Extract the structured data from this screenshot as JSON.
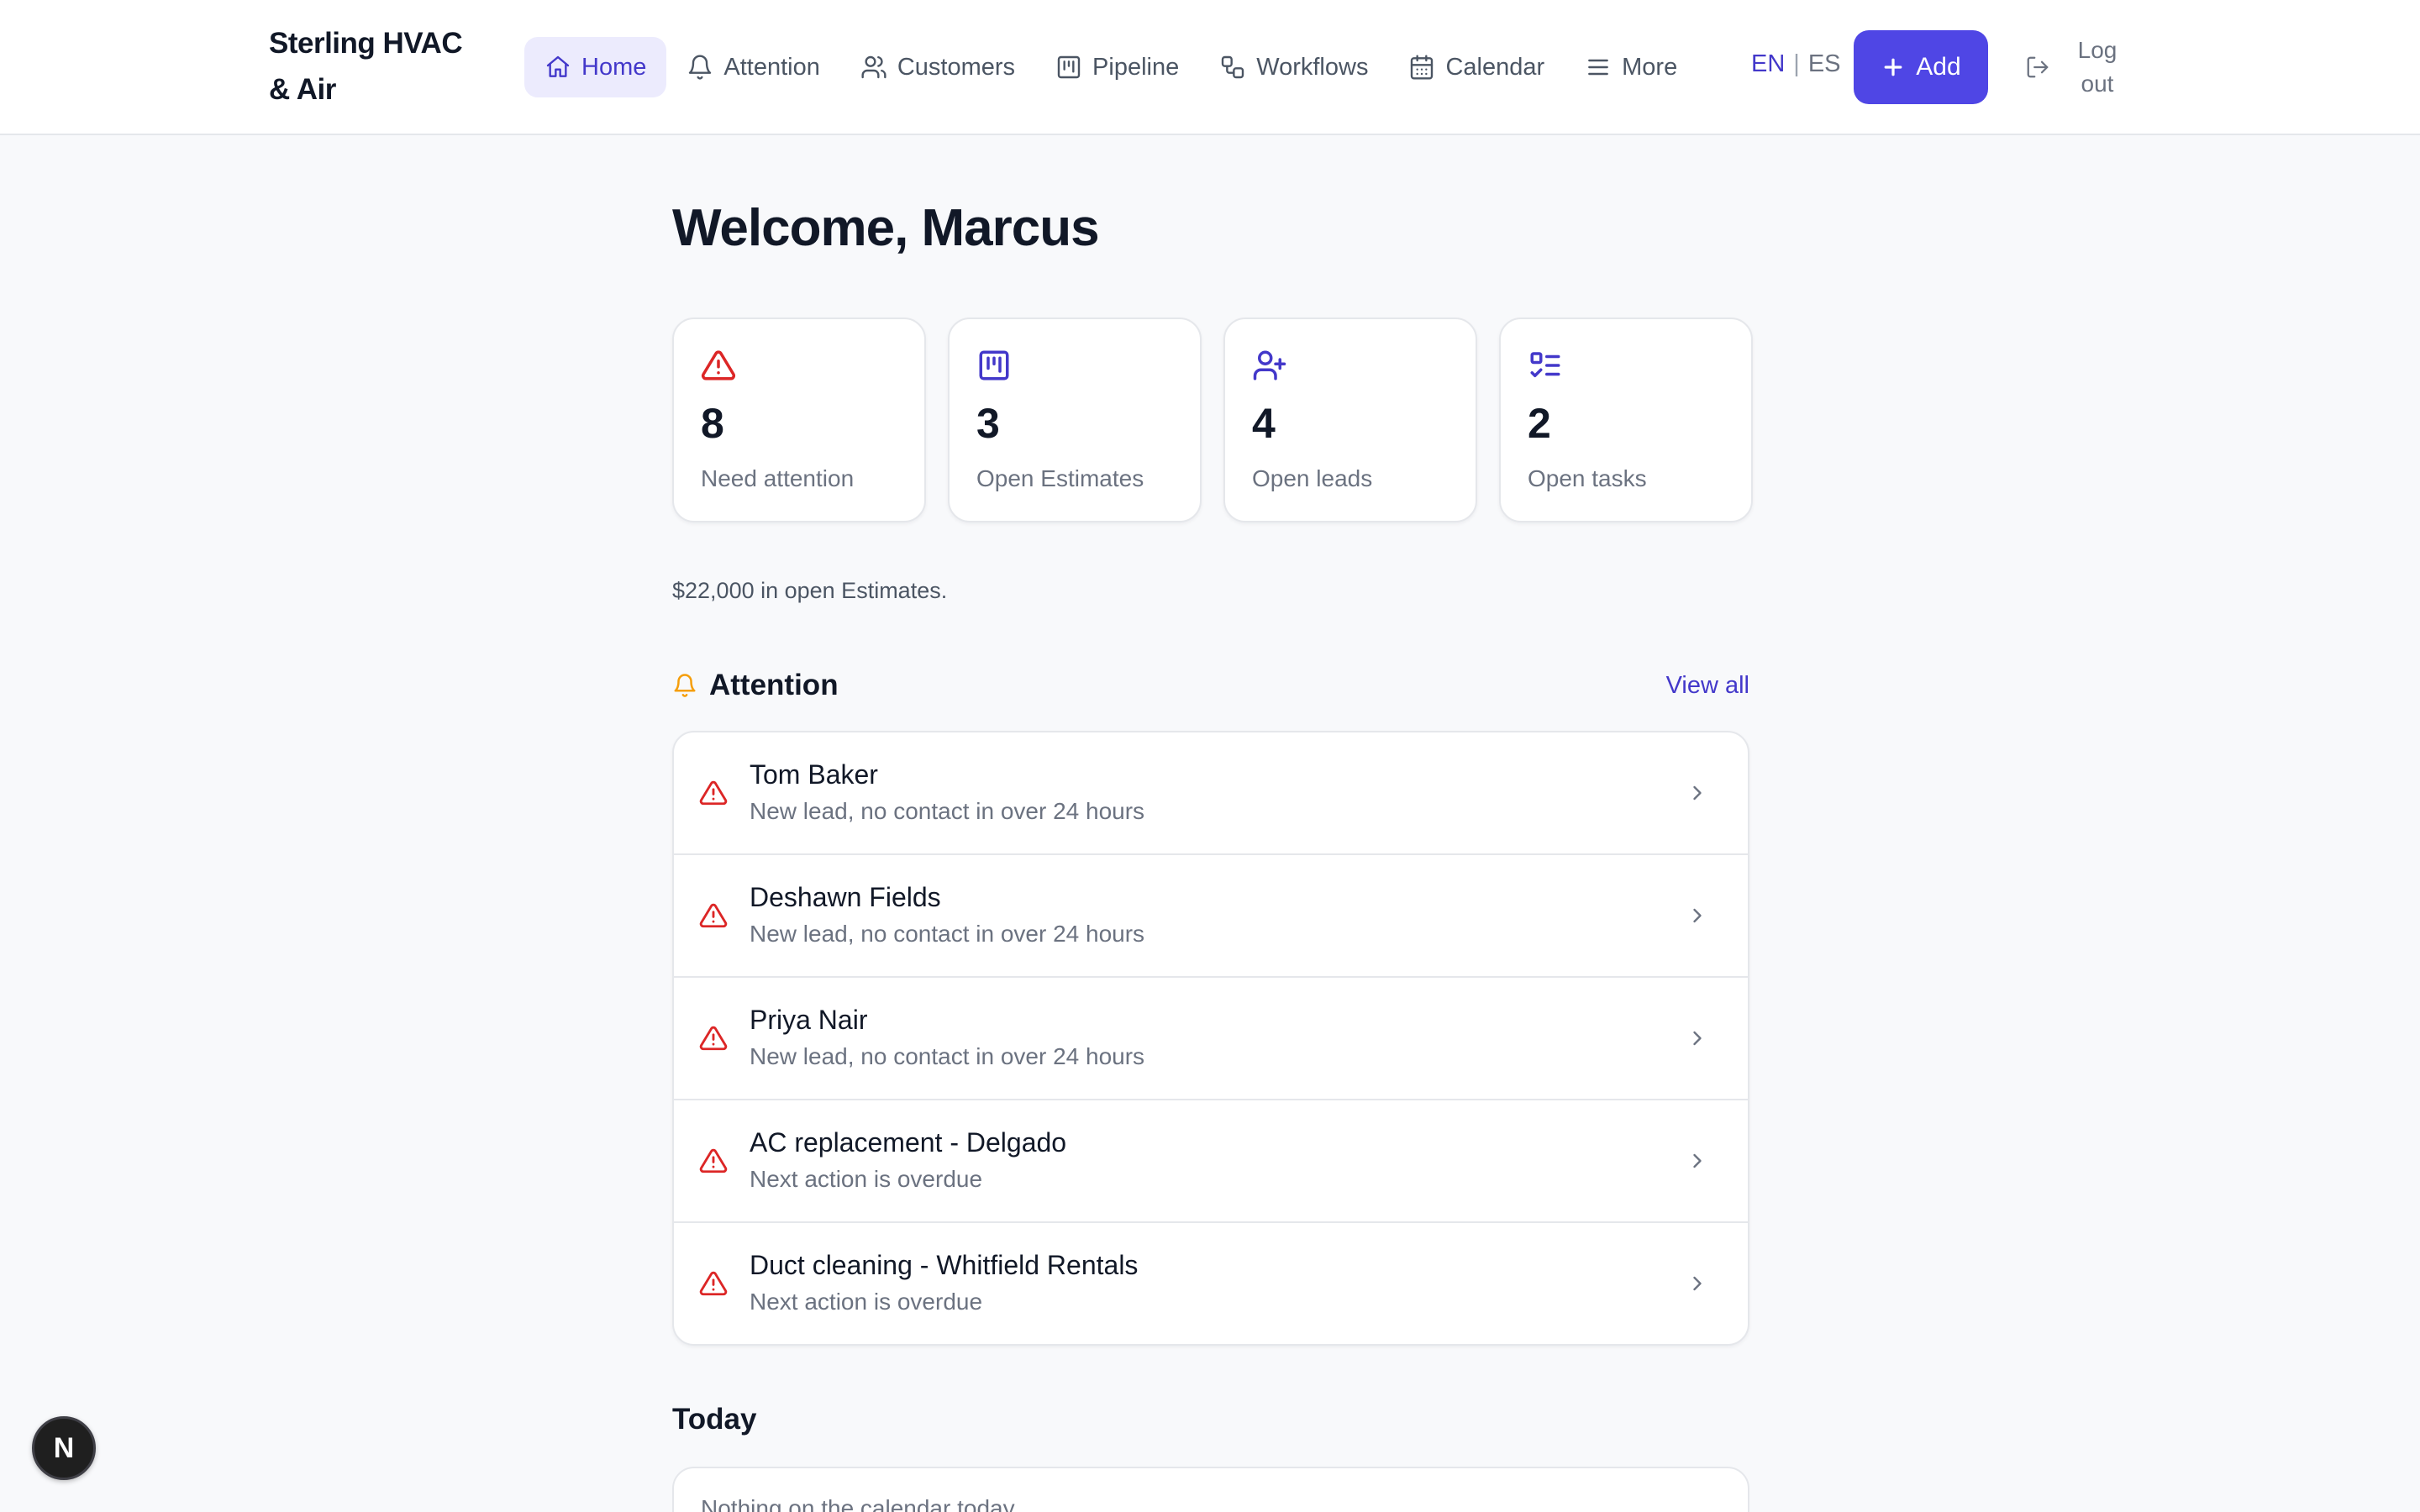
{
  "brand": {
    "name": "Sterling HVAC & Air"
  },
  "nav": {
    "items": [
      {
        "label": "Home",
        "icon": "home-icon",
        "active": true
      },
      {
        "label": "Attention",
        "icon": "bell-icon"
      },
      {
        "label": "Customers",
        "icon": "users-icon"
      },
      {
        "label": "Pipeline",
        "icon": "kanban-icon"
      },
      {
        "label": "Workflows",
        "icon": "workflow-icon"
      },
      {
        "label": "Calendar",
        "icon": "calendar-icon"
      },
      {
        "label": "More",
        "icon": "menu-icon"
      }
    ]
  },
  "language": {
    "en": "EN",
    "separator": "|",
    "es": "ES",
    "active": "EN"
  },
  "actions": {
    "add_label": "Add",
    "logout_label": "Log out"
  },
  "welcome": {
    "title": "Welcome, Marcus"
  },
  "stats": [
    {
      "value": "8",
      "label": "Need attention",
      "icon": "alert-triangle-icon",
      "color": "#dc2626"
    },
    {
      "value": "3",
      "label": "Open Estimates",
      "icon": "kanban-icon",
      "color": "#4338ca"
    },
    {
      "value": "4",
      "label": "Open leads",
      "icon": "user-plus-icon",
      "color": "#4338ca"
    },
    {
      "value": "2",
      "label": "Open tasks",
      "icon": "list-checks-icon",
      "color": "#4338ca"
    }
  ],
  "summary": {
    "text": "$22,000 in open Estimates."
  },
  "attention": {
    "title": "Attention",
    "view_all": "View all",
    "items": [
      {
        "name": "Tom Baker",
        "detail": "New lead, no contact in over 24 hours"
      },
      {
        "name": "Deshawn Fields",
        "detail": "New lead, no contact in over 24 hours"
      },
      {
        "name": "Priya Nair",
        "detail": "New lead, no contact in over 24 hours"
      },
      {
        "name": "AC replacement - Delgado",
        "detail": "Next action is overdue"
      },
      {
        "name": "Duct cleaning - Whitfield Rentals",
        "detail": "Next action is overdue"
      }
    ]
  },
  "today": {
    "title": "Today",
    "empty": "Nothing on the calendar today."
  },
  "dev_badge": {
    "letter": "N"
  },
  "colors": {
    "accent": "#4f46e5",
    "accent_text": "#4338ca",
    "danger": "#dc2626",
    "warning": "#f59e0b"
  }
}
